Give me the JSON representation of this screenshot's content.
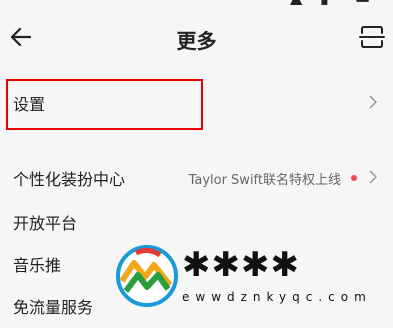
{
  "header": {
    "title": "更多",
    "back_icon": "arrow-left-icon",
    "scan_icon": "scan-icon"
  },
  "menu": {
    "settings": {
      "label": "设置"
    },
    "personalization": {
      "label": "个性化装扮中心",
      "note": "Taylor Swift联名特权上线",
      "dot_color": "#ee4b55"
    },
    "open_platform": {
      "label": "开放平台"
    },
    "music_push": {
      "label": "音乐推"
    },
    "free_data": {
      "label": "免流量服务"
    }
  },
  "watermark": {
    "url": "ewwdznkyqc.com"
  },
  "colors": {
    "background": "#f6f6f6",
    "highlight": "#e60000",
    "dot": "#ee4b55"
  }
}
